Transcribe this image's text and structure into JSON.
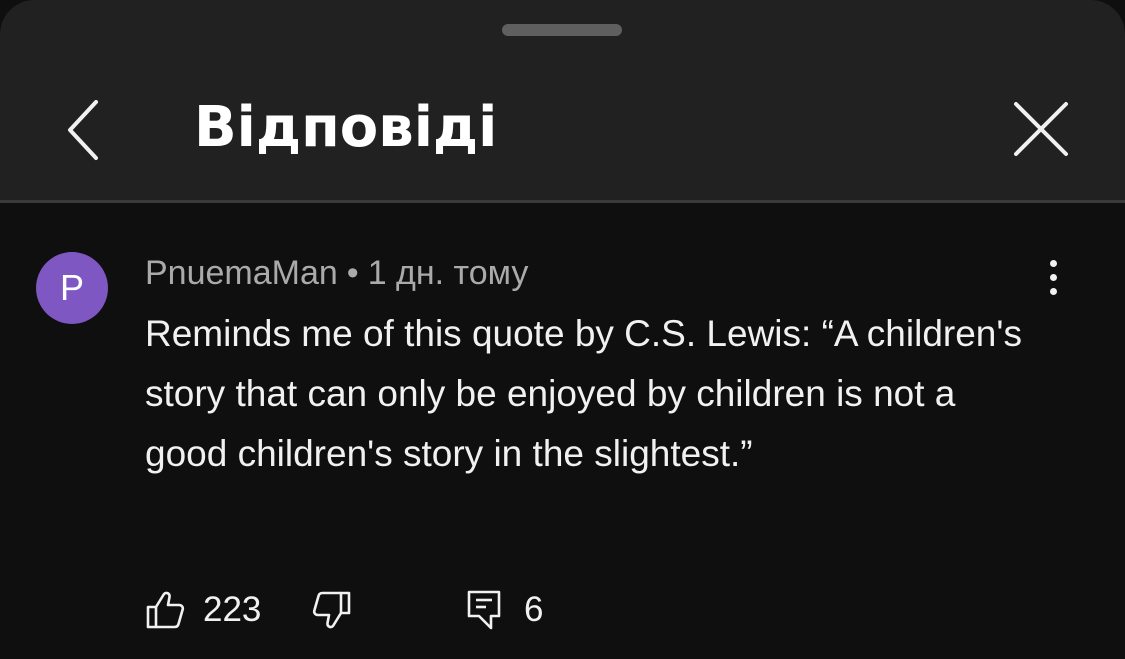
{
  "header": {
    "title": "Відповіді",
    "back_icon": "chevron-left-icon",
    "close_icon": "close-icon"
  },
  "comment": {
    "avatar_letter": "P",
    "avatar_color": "#7e57c2",
    "author": "PnuemaMan",
    "separator": "•",
    "time": "1 дн. тому",
    "text": "Reminds me of this quote by C.S. Lewis: “A children's story that can only be enjoyed by children is not a good children's story in the slightest.”",
    "more_icon": "more-vertical-icon",
    "likes": "223",
    "replies": "6"
  },
  "colors": {
    "header_bg": "#212121",
    "body_bg": "#0f0f0f",
    "text_primary": "#f1f1f1",
    "text_secondary": "#aaaaaa"
  }
}
